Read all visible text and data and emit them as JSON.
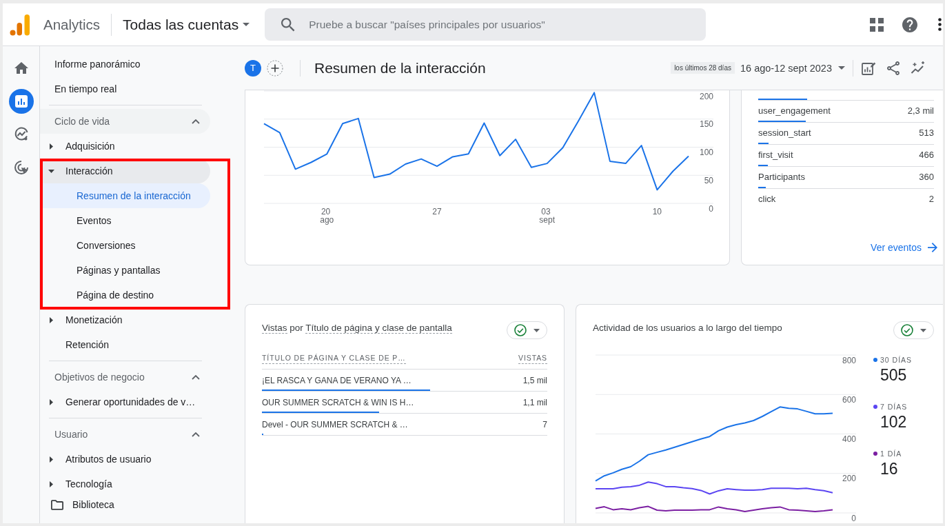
{
  "topbar": {
    "product": "Analytics",
    "account": "Todas las cuentas",
    "search_placeholder": "Pruebe a buscar \"países principales por usuarios\""
  },
  "rail": [
    {
      "kind": "home",
      "selected": false
    },
    {
      "kind": "reports",
      "selected": true
    },
    {
      "kind": "explore",
      "selected": false
    },
    {
      "kind": "advertising",
      "selected": false
    }
  ],
  "nav": {
    "top_items": [
      {
        "label": "Informe panorámico",
        "selected": false
      },
      {
        "label": "En tiempo real",
        "selected": false
      }
    ],
    "sections": [
      {
        "title": "Ciclo de vida",
        "expanded": true,
        "items": [
          {
            "kind": "group",
            "label": "Adquisición",
            "expanded": false,
            "highlighted": false
          },
          {
            "kind": "group",
            "label": "Interacción",
            "expanded": true,
            "highlighted": true,
            "children": [
              {
                "label": "Resumen de la interacción",
                "selected": true
              },
              {
                "label": "Eventos",
                "selected": false
              },
              {
                "label": "Conversiones",
                "selected": false
              },
              {
                "label": "Páginas y pantallas",
                "selected": false
              },
              {
                "label": "Página de destino",
                "selected": false
              }
            ]
          },
          {
            "kind": "group",
            "label": "Monetización",
            "expanded": false,
            "highlighted": false
          },
          {
            "kind": "link",
            "label": "Retención",
            "selected": false,
            "highlighted": false
          }
        ]
      },
      {
        "title": "Objetivos de negocio",
        "expanded": true,
        "items": [
          {
            "kind": "group",
            "label": "Generar oportunidades de v…",
            "expanded": false,
            "highlighted": false
          }
        ]
      },
      {
        "title": "Usuario",
        "expanded": true,
        "items": [
          {
            "kind": "group",
            "label": "Atributos de usuario",
            "expanded": false,
            "highlighted": false
          },
          {
            "kind": "group",
            "label": "Tecnología",
            "expanded": false,
            "highlighted": false
          }
        ]
      }
    ],
    "footer": {
      "label": "Biblioteca"
    }
  },
  "report_header": {
    "avatar": "T",
    "title": "Resumen de la interacción",
    "date_chip": "los últimos 28 días",
    "date_range": "16 ago-12 sept 2023"
  },
  "overview_chart": {
    "chart_data": {
      "type": "line",
      "grid": true,
      "categories": [
        null,
        null,
        null,
        null,
        "20 ago",
        null,
        null,
        null,
        null,
        null,
        null,
        "27",
        null,
        null,
        null,
        null,
        null,
        null,
        "03 sept",
        null,
        null,
        null,
        null,
        null,
        null,
        "10",
        null,
        null
      ],
      "ylim": [
        0,
        200
      ],
      "yticks": [
        0,
        50,
        100,
        150,
        200
      ],
      "series": [
        {
          "color": "#1a73e8",
          "values": [
            142,
            126,
            61,
            73,
            88,
            142,
            151,
            46,
            52,
            70,
            79,
            66,
            83,
            88,
            143,
            85,
            114,
            64,
            71,
            99,
            147,
            197,
            75,
            71,
            103,
            24,
            57,
            84
          ]
        }
      ]
    }
  },
  "events_card": {
    "rows": [
      {
        "level": 0.28
      },
      {
        "name": "user_engagement",
        "value": "2,3 mil",
        "level": 0.27
      },
      {
        "name": "session_start",
        "value": "513",
        "level": 0.06
      },
      {
        "name": "first_visit",
        "value": "466",
        "level": 0.055
      },
      {
        "name": "Participants",
        "value": "360",
        "level": 0.042
      },
      {
        "name": "click",
        "value": "2"
      }
    ],
    "link": "Ver eventos"
  },
  "views_card": {
    "title_metric": "Vistas",
    "title_joiner": "por",
    "title_dimension": "Título de página y clase de pantalla",
    "columns": [
      "TÍTULO DE PÁGINA Y CLASE DE P…",
      "VISTAS"
    ],
    "rows": [
      {
        "title": "¡EL RASCA Y GANA DE VERANO YA …",
        "views": "1,5 mil",
        "level": 0.59
      },
      {
        "title": "OUR SUMMER SCRATCH & WIN IS H…",
        "views": "1,1 mil",
        "level": 0.41
      },
      {
        "title": "Devel - OUR SUMMER SCRATCH & …",
        "views": "7",
        "level": 0.005
      }
    ]
  },
  "activity_card": {
    "title": "Actividad de los usuarios a lo largo del tiempo",
    "legend_values": [
      "505",
      "102",
      "16"
    ],
    "chart_data": {
      "type": "line",
      "grid": true,
      "ylim": [
        0,
        800
      ],
      "yticks": [
        0,
        200,
        400,
        600,
        800
      ],
      "series": [
        {
          "name": "30 DÍAS",
          "color": "#1a73e8",
          "values": [
            162,
            188,
            203,
            221,
            234,
            262,
            295,
            307,
            319,
            333,
            347,
            361,
            375,
            387,
            416,
            435,
            447,
            456,
            468,
            489,
            513,
            537,
            530,
            527,
            515,
            502,
            502,
            505
          ]
        },
        {
          "name": "7 DÍAS",
          "color": "#5b45f2",
          "values": [
            122,
            122,
            122,
            130,
            133,
            140,
            156,
            148,
            133,
            133,
            127,
            123,
            114,
            96,
            112,
            122,
            118,
            115,
            115,
            118,
            125,
            125,
            125,
            122,
            125,
            118,
            113,
            102
          ]
        },
        {
          "name": "1 DÍA",
          "color": "#7b1fa2",
          "values": [
            23,
            31,
            16,
            21,
            16,
            26,
            33,
            14,
            10,
            14,
            14,
            14,
            16,
            16,
            30,
            21,
            16,
            7,
            14,
            21,
            26,
            30,
            16,
            14,
            10,
            7,
            10,
            16
          ]
        }
      ]
    }
  }
}
